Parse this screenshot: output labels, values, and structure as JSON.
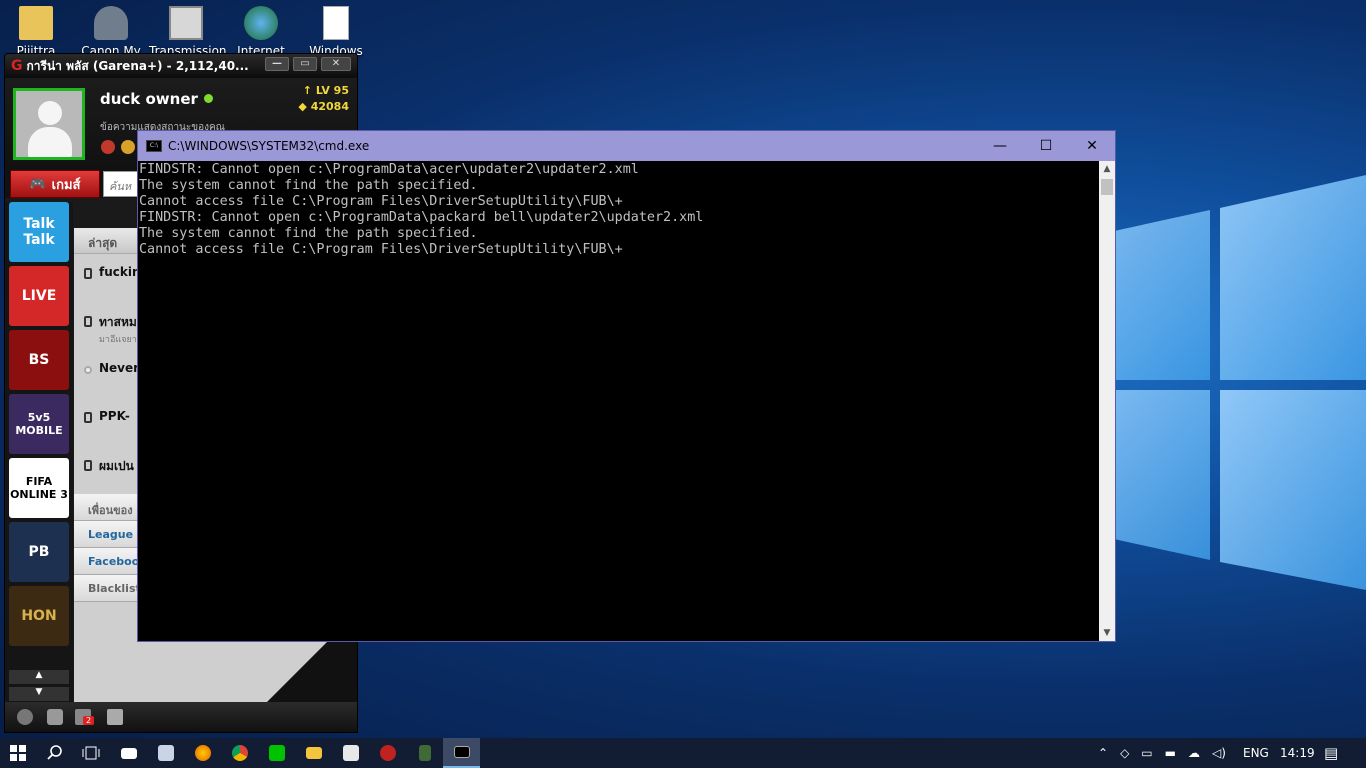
{
  "desktop": {
    "icons": [
      {
        "label": "Pijittra",
        "icon": "folder-user-icon"
      },
      {
        "label": "Canon My",
        "icon": "canon-icon"
      },
      {
        "label": "Transmission",
        "icon": "transmission-icon"
      },
      {
        "label": "Internet",
        "icon": "internet-download-icon"
      },
      {
        "label": "Windows",
        "icon": "file-icon"
      }
    ]
  },
  "garena": {
    "title": "การีน่า พลัส (Garena+) - 2,112,40...",
    "username": "duck owner",
    "status_message": "ข้อความแสดงสถานะของคุณ",
    "level": "LV 95",
    "points": "42084",
    "games_button": "เกมส์",
    "search_placeholder": "ค้นห",
    "game_tiles": [
      {
        "label": "Talk Talk",
        "color": "#2aa0e0"
      },
      {
        "label": "LIVE",
        "color": "#d42828"
      },
      {
        "label": "BS",
        "color": "#8b0f0f"
      },
      {
        "label": "5v5 MOBILE",
        "color": "#3a2a60"
      },
      {
        "label": "FIFA ONLINE 3",
        "color": "#ffffff"
      },
      {
        "label": "PB",
        "color": "#1d3050"
      },
      {
        "label": "HON",
        "color": "#3d2a12"
      }
    ],
    "recent_group": "ล่าสุด",
    "friends": [
      {
        "name": "fuckin",
        "sub": ""
      },
      {
        "name": "ทาสหม",
        "sub": "มาอีแจยา"
      },
      {
        "name": "Never",
        "sub": ""
      },
      {
        "name": "PPK-",
        "sub": ""
      },
      {
        "name": "ผมเปน",
        "sub": ""
      }
    ],
    "sections": [
      "เพื่อนของ",
      "League o",
      "Faceboo",
      "Blacklist"
    ],
    "notification_count": "2"
  },
  "cmd": {
    "title": "C:\\WINDOWS\\SYSTEM32\\cmd.exe",
    "minimize": "—",
    "maximize": "☐",
    "close": "✕",
    "output": "FINDSTR: Cannot open c:\\ProgramData\\acer\\updater2\\updater2.xml\nThe system cannot find the path specified.\nCannot access file C:\\Program Files\\DriverSetupUtility\\FUB\\+\nFINDSTR: Cannot open c:\\ProgramData\\packard bell\\updater2\\updater2.xml\nThe system cannot find the path specified.\nCannot access file C:\\Program Files\\DriverSetupUtility\\FUB\\+"
  },
  "taskbar": {
    "language": "ENG",
    "time": "14:19"
  }
}
